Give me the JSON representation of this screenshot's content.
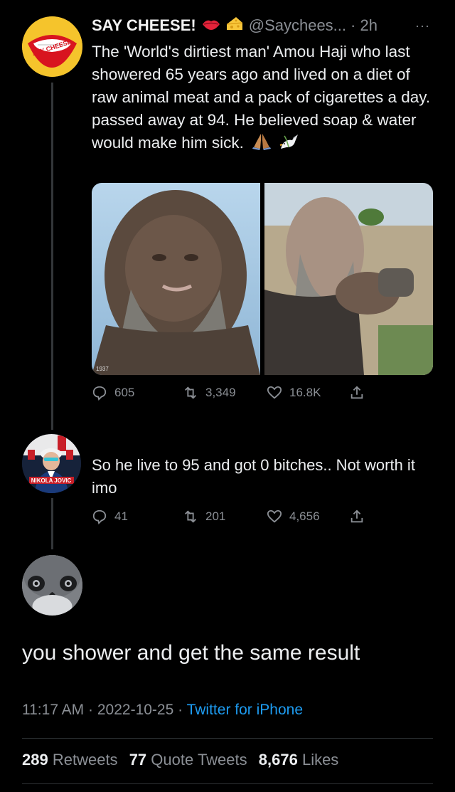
{
  "tweet1": {
    "display_name": "SAY CHEESE!",
    "emojis": [
      "lips-emoji",
      "cheese-emoji"
    ],
    "handle": "@Saychees...",
    "time": "· 2h",
    "more": "···",
    "text": "The 'World's dirtiest man' Amou Haji who last showered 65 years ago and lived on a diet of raw animal meat and a pack of cigarettes a day. passed away at 94. He believed soap & water would make him sick.",
    "trailing_emojis": [
      "folded-hands-emoji",
      "dove-emoji"
    ],
    "avatar_text": "SAY CHEESE",
    "media_caption": "1937",
    "stats": {
      "replies": "605",
      "retweets": "3,349",
      "likes": "16.8K"
    }
  },
  "tweet2": {
    "avatar_text": "NIKOLA JOVIC",
    "text": "So he live to 95 and got 0 bitches.. Not worth it imo",
    "stats": {
      "replies": "41",
      "retweets": "201",
      "likes": "4,656"
    }
  },
  "main_tweet": {
    "text": "you shower and get the same result",
    "time": "11:17 AM",
    "separator": "·",
    "date": "2022-10-25",
    "source": "Twitter for iPhone",
    "retweets_count": "289",
    "retweets_label": "Retweets",
    "quotes_count": "77",
    "quotes_label": "Quote Tweets",
    "likes_count": "8,676",
    "likes_label": "Likes"
  },
  "colors": {
    "background": "#000000",
    "text": "#e7e9ea",
    "secondary": "#8b8f95",
    "link": "#1d9bf0",
    "divider": "#2f3336"
  }
}
